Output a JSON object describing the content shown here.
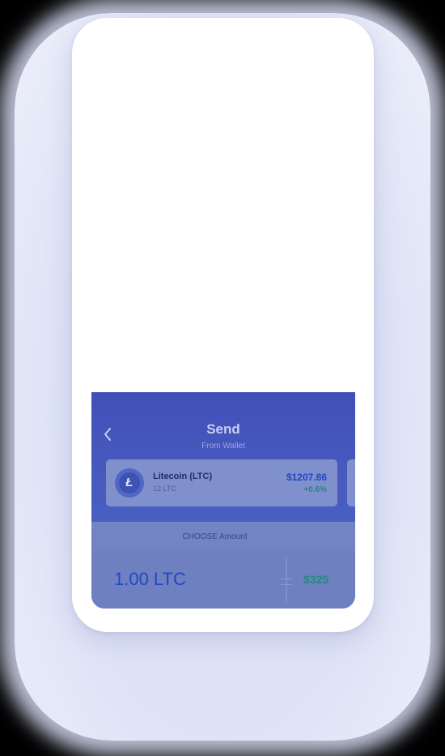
{
  "header": {
    "title": "Send",
    "subtitle": "From Wallet",
    "back_icon": "chevron-left-icon"
  },
  "wallet_card": {
    "coin_symbol": "Ł",
    "coin_icon": "litecoin-icon",
    "name": "Litecoin (LTC)",
    "quantity": "12 LTC",
    "price": "$1207.86",
    "change": "+0.6%"
  },
  "amount": {
    "label": "CHOOSE Amount",
    "crypto_value": "1.00 LTC",
    "fiat_value": "$325"
  },
  "colors": {
    "header": "#4150b9",
    "accent_blue": "#2344bf",
    "positive_green": "#2f7d86"
  }
}
